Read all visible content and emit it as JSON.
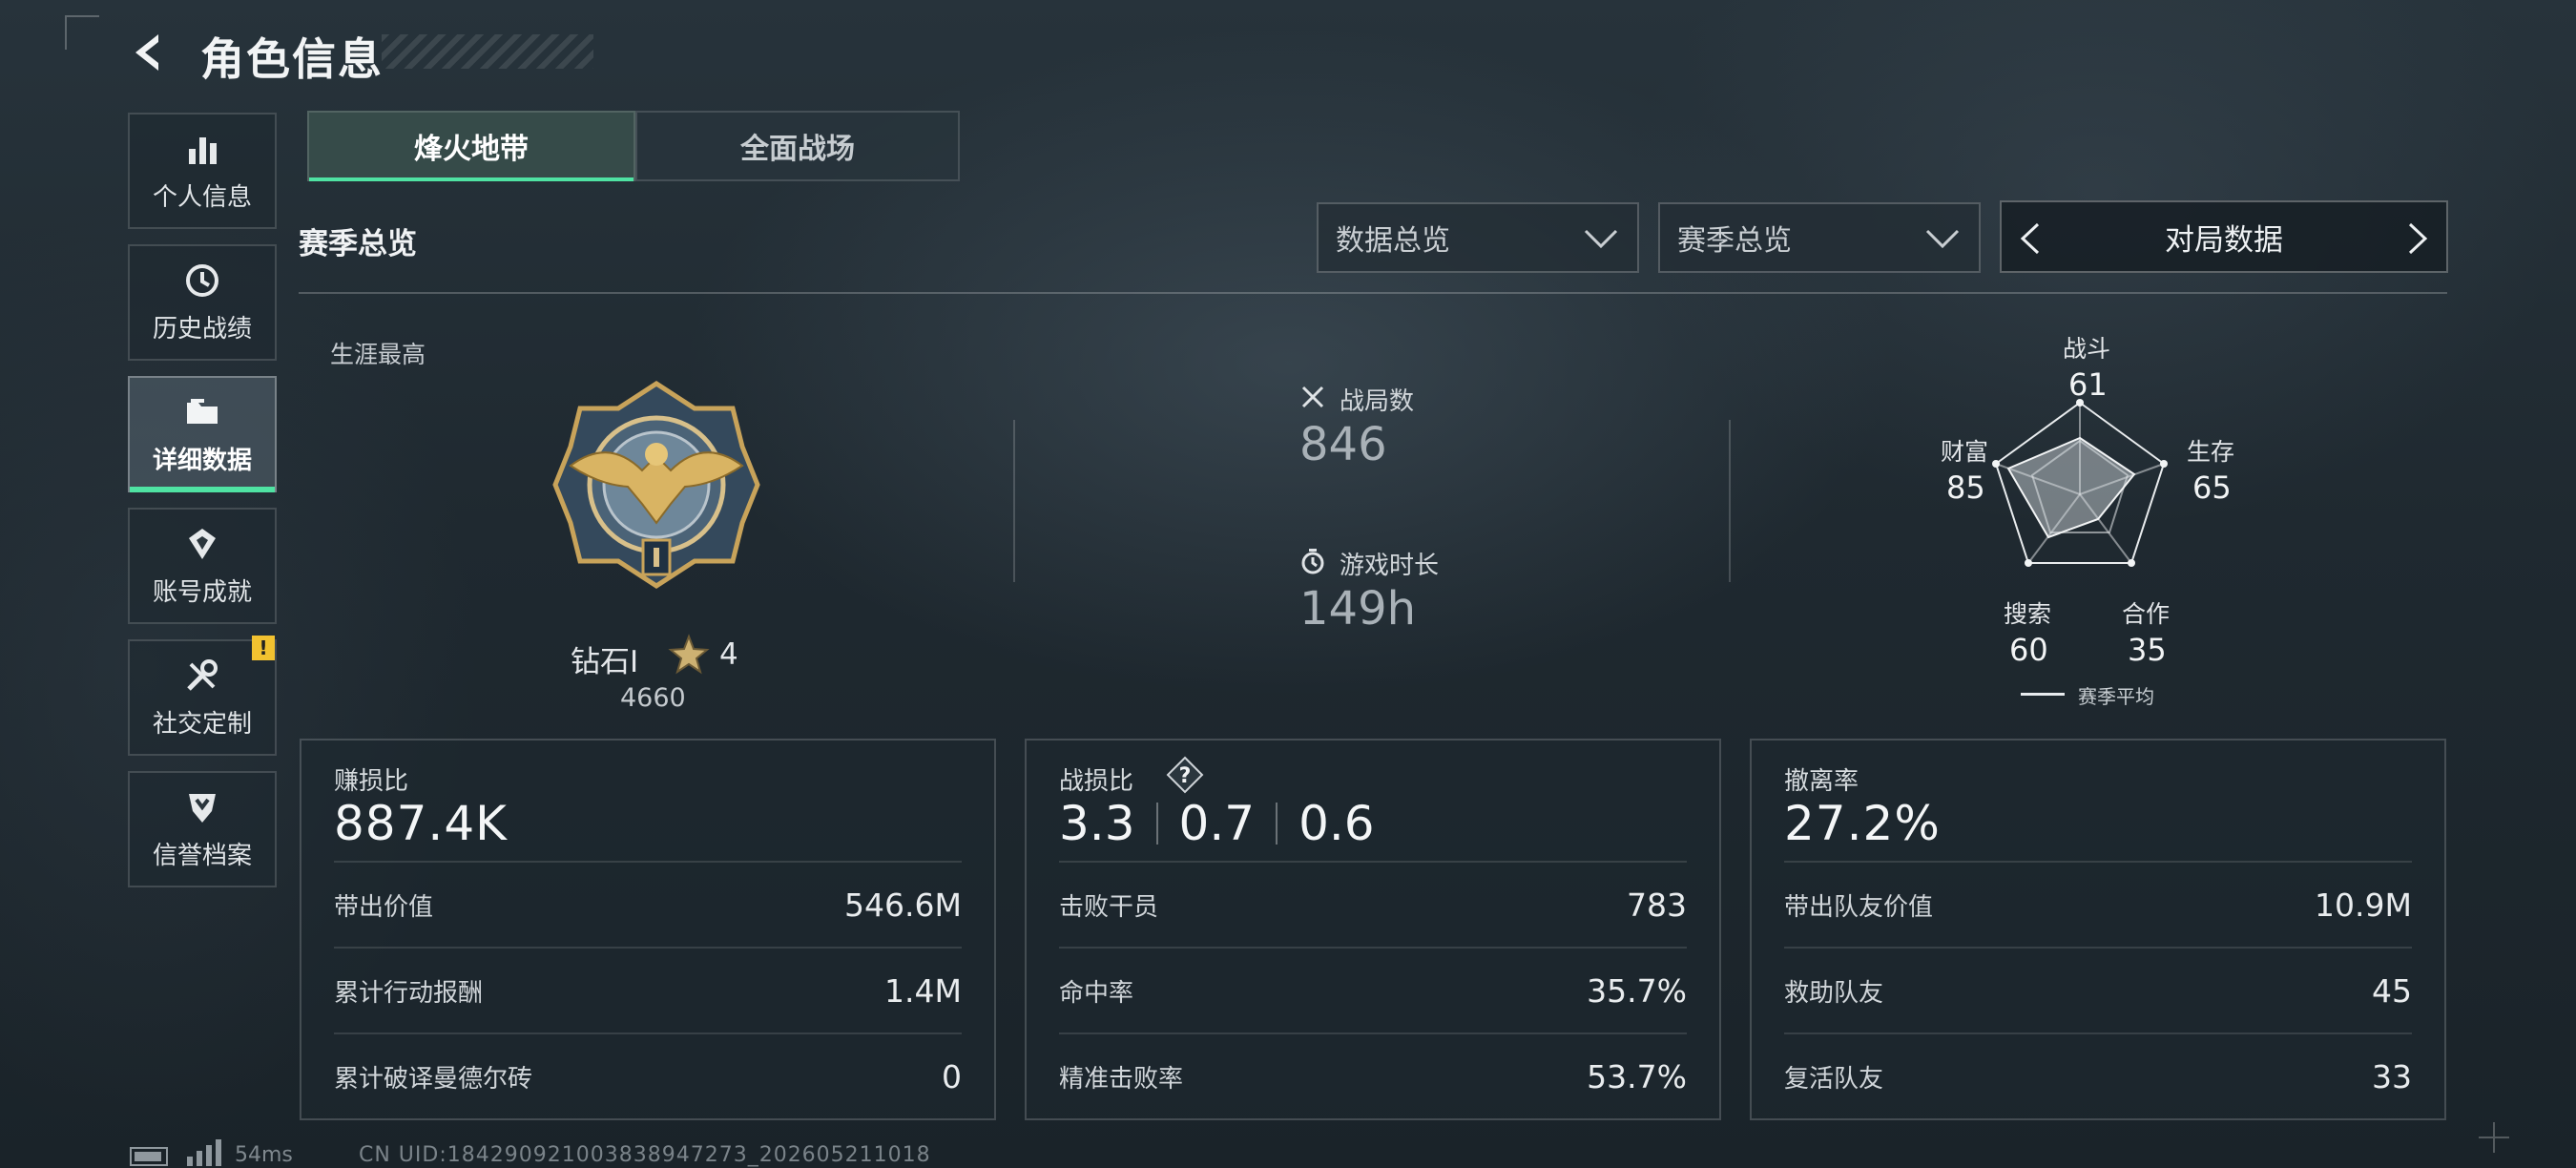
{
  "header": {
    "title": "角色信息"
  },
  "sidebar": {
    "items": [
      {
        "label": "个人信息",
        "icon": "bar-chart-icon"
      },
      {
        "label": "历史战绩",
        "icon": "clock-icon"
      },
      {
        "label": "详细数据",
        "icon": "folder-icon",
        "active": true
      },
      {
        "label": "账号成就",
        "icon": "achievement-icon"
      },
      {
        "label": "社交定制",
        "icon": "wrench-icon",
        "badge": "!"
      },
      {
        "label": "信誉档案",
        "icon": "shield-icon"
      }
    ]
  },
  "tabs": [
    {
      "label": "烽火地带",
      "active": true
    },
    {
      "label": "全面战场",
      "active": false
    }
  ],
  "section_title": "赛季总览",
  "filters": {
    "dropdown1": "数据总览",
    "dropdown2": "赛季总览",
    "switcher": "对局数据"
  },
  "career": {
    "label": "生涯最高",
    "rank_name": "钻石Ⅰ",
    "stars": "4",
    "score": "4660"
  },
  "stats": {
    "matches_label": "战局数",
    "matches_value": "846",
    "playtime_label": "游戏时长",
    "playtime_value": "149h"
  },
  "radar": {
    "axes": [
      {
        "label": "战斗",
        "value": "61"
      },
      {
        "label": "生存",
        "value": "65"
      },
      {
        "label": "合作",
        "value": "35"
      },
      {
        "label": "搜索",
        "value": "60"
      },
      {
        "label": "财富",
        "value": "85"
      }
    ],
    "legend": "赛季平均"
  },
  "panels": {
    "profit": {
      "title": "赚损比",
      "value": "887.4K",
      "rows": [
        {
          "k": "带出价值",
          "v": "546.6M"
        },
        {
          "k": "累计行动报酬",
          "v": "1.4M"
        },
        {
          "k": "累计破译曼德尔砖",
          "v": "0"
        }
      ]
    },
    "kd": {
      "title": "战损比",
      "values": [
        "3.3",
        "0.7",
        "0.6"
      ],
      "rows": [
        {
          "k": "击败干员",
          "v": "783"
        },
        {
          "k": "命中率",
          "v": "35.7%"
        },
        {
          "k": "精准击败率",
          "v": "53.7%"
        }
      ]
    },
    "extract": {
      "title": "撤离率",
      "value": "27.2%",
      "rows": [
        {
          "k": "带出队友价值",
          "v": "10.9M"
        },
        {
          "k": "救助队友",
          "v": "45"
        },
        {
          "k": "复活队友",
          "v": "33"
        }
      ]
    }
  },
  "footer": {
    "ping": "54ms",
    "uid": "CN UID:184290921003838947273_202605211018"
  },
  "colors": {
    "accent": "#4fe3a3",
    "badge": "#f2c230"
  }
}
